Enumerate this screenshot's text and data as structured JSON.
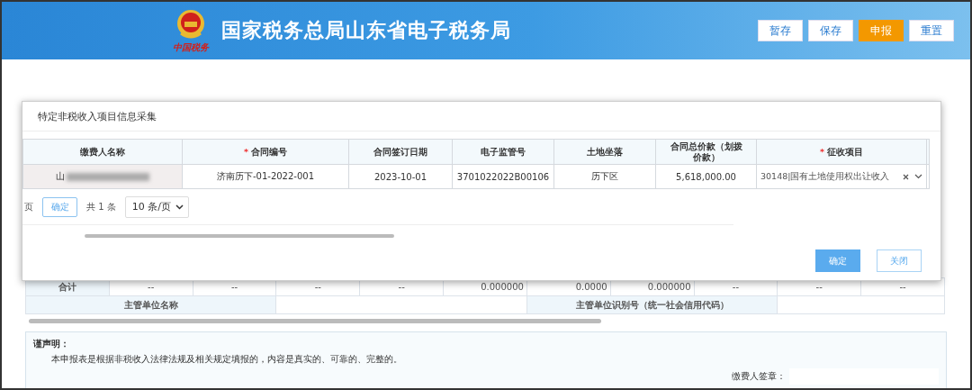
{
  "header": {
    "title": "国家税务总局山东省电子税务局",
    "logo_caption": "中国税务",
    "buttons": [
      {
        "label": "暂存",
        "kind": "default"
      },
      {
        "label": "保存",
        "kind": "default"
      },
      {
        "label": "申报",
        "kind": "primary"
      },
      {
        "label": "重置",
        "kind": "default"
      }
    ]
  },
  "report": {
    "total_row": [
      "合计",
      "--",
      "--",
      "--",
      "--",
      "0.000000",
      "0.0000",
      "0.000000",
      "--",
      "--",
      "--"
    ],
    "unit_row": [
      {
        "label": "主管单位名称"
      },
      {
        "label": "主管单位识别号（统一社会信用代码）"
      }
    ],
    "declaration": {
      "heading": "谨声明：",
      "text": "本申报表是根据非税收入法律法规及相关规定填报的，内容是真实的、可靠的、完整的。",
      "signature_label": "缴费人签章："
    }
  },
  "dialog": {
    "title": "特定非税收入项目信息采集",
    "required_marker": "*",
    "columns": [
      {
        "label": "缴费人名称",
        "required": false
      },
      {
        "label": "合同编号",
        "required": true
      },
      {
        "label": "合同签订日期",
        "required": false
      },
      {
        "label": "电子监管号",
        "required": false
      },
      {
        "label": "土地坐落",
        "required": false
      },
      {
        "label": "合同总价款（划拨价款）",
        "required": false
      },
      {
        "label": "征收项目",
        "required": true
      }
    ],
    "rows": [
      {
        "cells": [
          {
            "kind": "redacted",
            "text": "山"
          },
          {
            "kind": "text",
            "text": "济南历下-01-2022-001"
          },
          {
            "kind": "text",
            "text": "2023-10-01"
          },
          {
            "kind": "text",
            "text": "3701022022B00106"
          },
          {
            "kind": "text",
            "text": "历下区"
          },
          {
            "kind": "text",
            "text": "5,618,000.00"
          },
          {
            "kind": "select",
            "text": "30148|国有土地使用权出让收入"
          }
        ]
      }
    ],
    "pagination": {
      "page_fragment": "页",
      "confirm": "确定",
      "total": "共 1 条",
      "page_size": "10 条/页"
    },
    "buttons": [
      {
        "label": "确定",
        "kind": "primary"
      },
      {
        "label": "关闭",
        "kind": "default"
      }
    ]
  }
}
